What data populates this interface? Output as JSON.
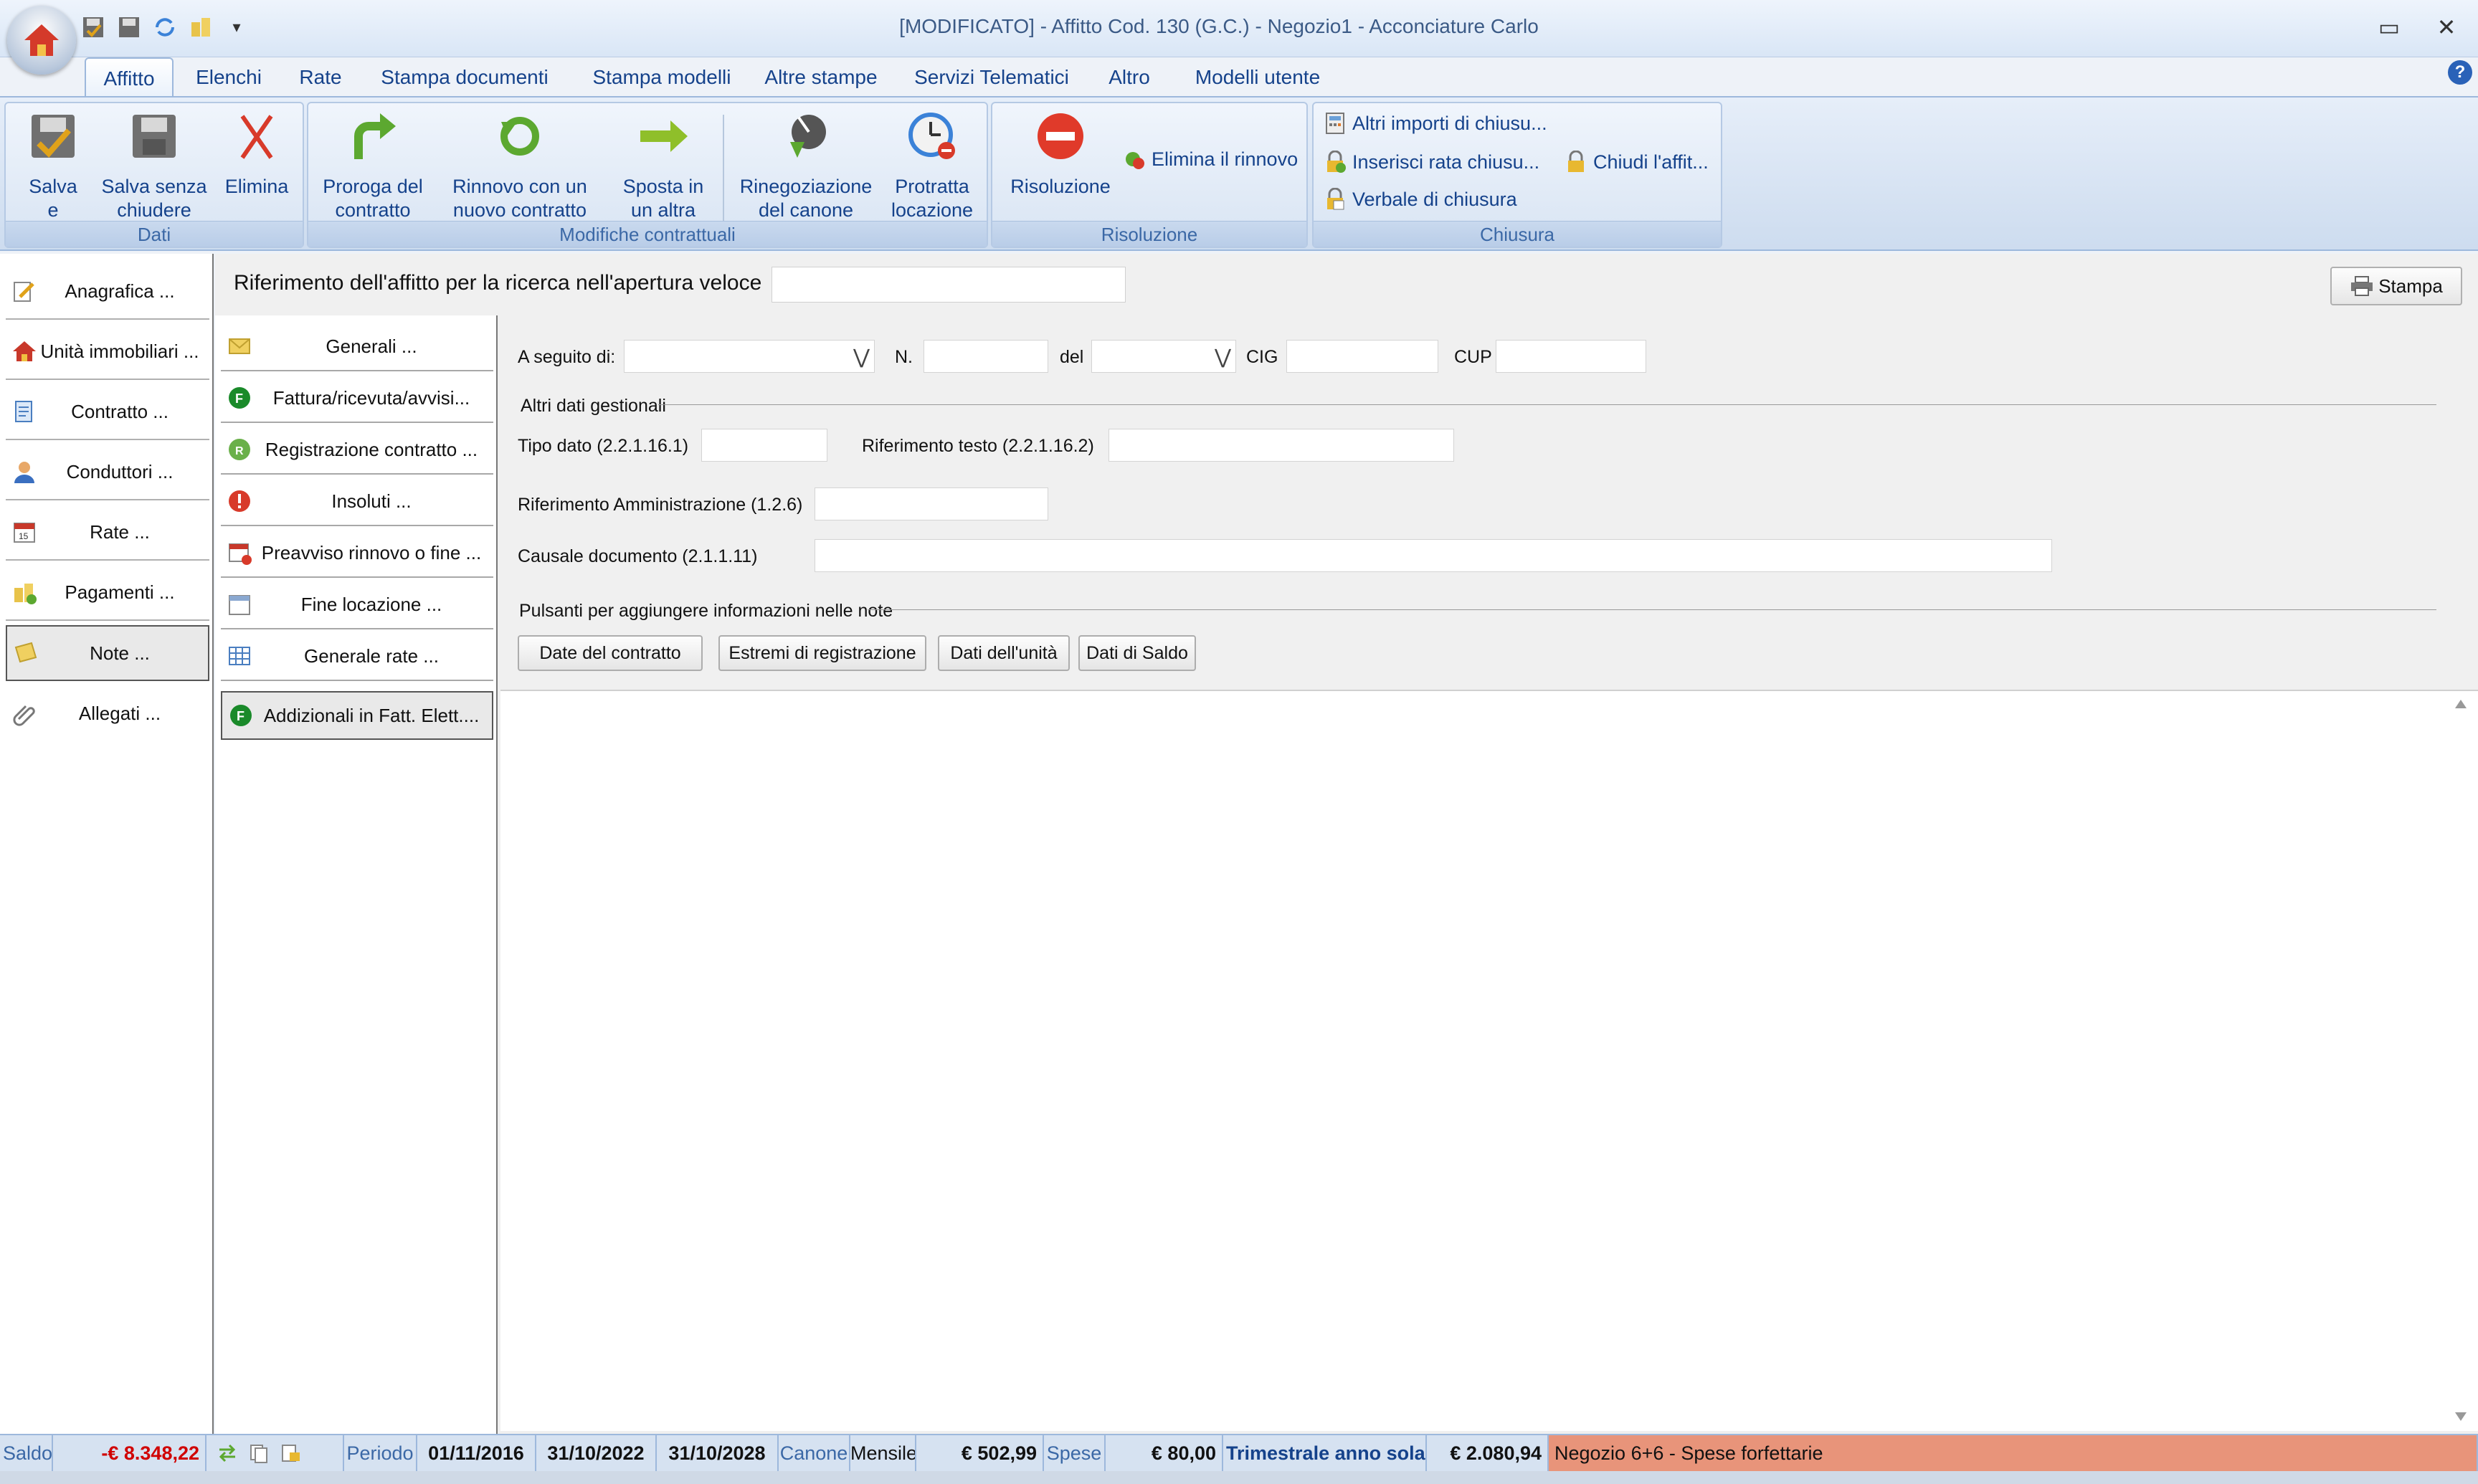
{
  "window": {
    "title": "[MODIFICATO] - Affitto Cod. 130 (G.C.) - Negozio1 - Acconciature Carlo",
    "minimize": "▭",
    "close": "✕"
  },
  "tabs": [
    "Affitto",
    "Elenchi",
    "Rate",
    "Stampa documenti",
    "Stampa modelli",
    "Altre stampe",
    "Servizi Telematici",
    "Altro",
    "Modelli utente"
  ],
  "ribbon": {
    "dati": {
      "label": "Dati",
      "salva_chiudi": "Salva e chiudi",
      "salva_senza": "Salva senza chiudere",
      "elimina": "Elimina"
    },
    "modifiche": {
      "label": "Modifiche contrattuali",
      "proroga": "Proroga del contratto",
      "rinnovo": "Rinnovo con un nuovo contratto",
      "sposta": "Sposta in un altra unità",
      "rinegoziazione": "Rinegoziazione del canone",
      "protratta": "Protratta locazione"
    },
    "risoluzione": {
      "label": "Risoluzione",
      "risoluzione": "Risoluzione",
      "elimina_rinnovo": "Elimina il rinnovo"
    },
    "chiusura": {
      "label": "Chiusura",
      "altri_importi": "Altri importi di chiusu...",
      "inserisci_rata": "Inserisci rata chiusu...",
      "chiudi_affitto": "Chiudi l'affit...",
      "verbale": "Verbale di chiusura"
    }
  },
  "left_nav": [
    "Anagrafica ...",
    "Unità immobiliari ...",
    "Contratto ...",
    "Conduttori ...",
    "Rate ...",
    "Pagamenti ...",
    "Note ...",
    "Allegati ..."
  ],
  "sub_nav": [
    "Generali ...",
    "Fattura/ricevuta/avvisi...",
    "Registrazione contratto ...",
    "Insoluti ...",
    "Preavviso rinnovo o fine ...",
    "Fine locazione ...",
    "Generale rate ...",
    "Addizionali in Fatt. Elett...."
  ],
  "header": {
    "ref_label": "Riferimento dell'affitto per la ricerca nell'apertura veloce",
    "ref_value": "",
    "print": "Stampa"
  },
  "form": {
    "a_seguito": "A seguito di:",
    "n": "N.",
    "del": "del",
    "cig": "CIG",
    "cup": "CUP",
    "dd_glyph": "⋁",
    "altri_dati": "Altri dati gestionali",
    "tipo_dato": "Tipo dato (2.2.1.16.1)",
    "riferimento_testo": "Riferimento testo (2.2.1.16.2)",
    "rif_amm": "Riferimento Amministrazione (1.2.6)",
    "causale": "Causale documento (2.1.1.11)",
    "pulsanti": "Pulsanti per aggiungere informazioni nelle note",
    "buttons": [
      "Date del contratto",
      "Estremi di registrazione",
      "Dati dell'unità",
      "Dati di Saldo"
    ]
  },
  "status": {
    "saldo_label": "Saldo",
    "saldo": "-€ 8.348,22",
    "periodo_label": "Periodo",
    "d1": "01/11/2016",
    "d2": "31/10/2022",
    "d3": "31/10/2028",
    "canone_label": "Canone",
    "mensile": "Mensile",
    "canone": "€ 502,99",
    "spese_label": "Spese",
    "spese": "€ 80,00",
    "trimestrale": "Trimestrale anno sola",
    "totale": "€ 2.080,94",
    "nota": "Negozio 6+6 - Spese forfettarie"
  },
  "colors": {
    "accent": "#15428b",
    "saldo": "#d00000",
    "status_note": "#e8947a"
  }
}
